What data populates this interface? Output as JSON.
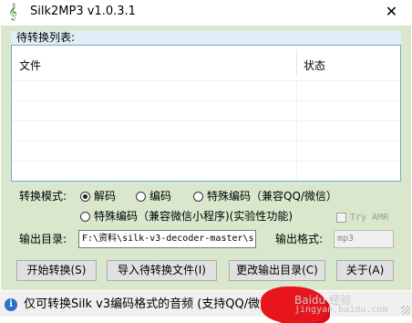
{
  "window": {
    "title": "Silk2MP3 v1.0.3.1",
    "app_icon": "music-note-icon",
    "close_glyph": "✕"
  },
  "list": {
    "header": "待转换列表:",
    "columns": [
      "文件",
      "状态"
    ],
    "rows": []
  },
  "mode": {
    "label": "转换模式:",
    "options": [
      "解码",
      "编码",
      "特殊编码（兼容QQ/微信）",
      "特殊编码（兼容微信小程序)(实验性功能)"
    ],
    "selected": "解码"
  },
  "try_amr": {
    "label": "Try AMR",
    "checked": false,
    "enabled": false
  },
  "output": {
    "dir_label": "输出目录:",
    "dir_value": "F:\\资料\\silk-v3-decoder-master\\s",
    "format_label": "输出格式:",
    "format_value": "mp3"
  },
  "buttons": {
    "start": "开始转换(S)",
    "import": "导入待转换文件(I)",
    "change_dir": "更改输出目录(C)",
    "about": "关于(A)"
  },
  "status": {
    "icon": "info-icon",
    "text": "仅可转换Silk v3编码格式的音频 (支持QQ/微信)"
  },
  "watermark": {
    "line1": "Baidu 经验",
    "line2": "jingyan.baidu.com"
  },
  "colors": {
    "client_bg": "#d9e8cd",
    "group_header_bg": "#e0eef7",
    "list_border": "#7aa8c8",
    "status_bg": "#f0f0f0",
    "info_icon": "#2a6fc9",
    "blob": "#e8151d"
  }
}
